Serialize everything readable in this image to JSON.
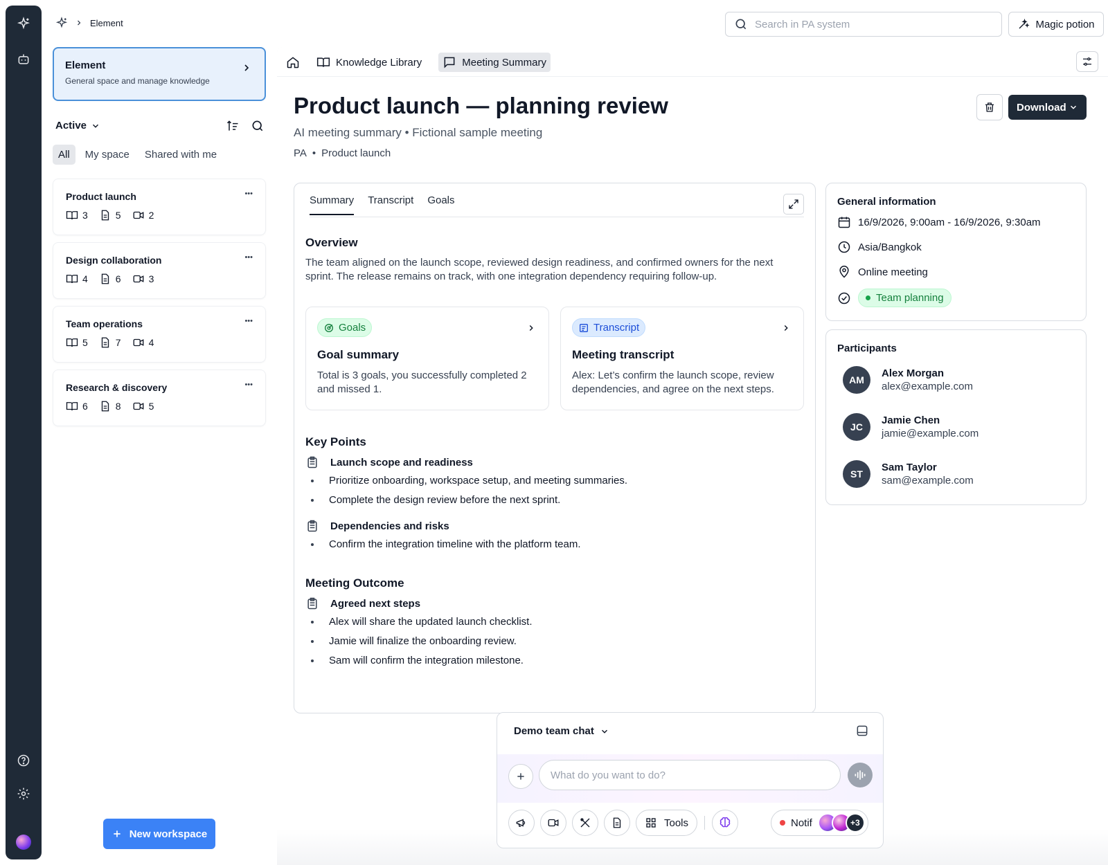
{
  "topbar": {
    "crumb": "Element",
    "search_placeholder": "Search in PA system",
    "magic_label": "Magic potion"
  },
  "sidebar": {
    "space": {
      "title": "Element",
      "description": "General space and manage knowledge"
    },
    "filter_label": "Active",
    "tabs": [
      "All",
      "My space",
      "Shared with me"
    ],
    "workspaces": [
      {
        "name": "Product launch",
        "books": "3",
        "docs": "5",
        "videos": "2"
      },
      {
        "name": "Design collaboration",
        "books": "4",
        "docs": "6",
        "videos": "3"
      },
      {
        "name": "Team operations",
        "books": "5",
        "docs": "7",
        "videos": "4"
      },
      {
        "name": "Research & discovery",
        "books": "6",
        "docs": "8",
        "videos": "5"
      }
    ],
    "new_workspace": "New workspace"
  },
  "breadcrumb": {
    "library": "Knowledge Library",
    "current": "Meeting Summary"
  },
  "meeting": {
    "title": "Product launch — planning review",
    "subtitle": "AI meeting summary • Fictional sample meeting",
    "tag_a": "PA",
    "tag_sep": "•",
    "tag_b": "Product launch",
    "download_label": "Download"
  },
  "tabs": [
    "Summary",
    "Transcript",
    "Goals"
  ],
  "summary": {
    "overview_title": "Overview",
    "overview_text": "The team aligned on the launch scope, reviewed design readiness, and confirmed owners for the next sprint. The release remains on track, with one integration dependency requiring follow-up.",
    "goals_card": {
      "badge": "Goals",
      "title": "Goal summary",
      "text": "Total is 3 goals, you successfully completed 2 and missed 1."
    },
    "transcript_card": {
      "badge": "Transcript",
      "title": "Meeting transcript",
      "text": "Alex: Let’s confirm the launch scope, review dependencies, and agree on the next steps."
    },
    "key_points_title": "Key Points",
    "key_points": [
      {
        "heading": "Launch scope and readiness",
        "items": [
          "Prioritize onboarding, workspace setup, and meeting summaries.",
          "Complete the design review before the next sprint."
        ]
      },
      {
        "heading": "Dependencies and risks",
        "items": [
          "Confirm the integration timeline with the platform team."
        ]
      }
    ],
    "outcome_title": "Meeting Outcome",
    "outcome": {
      "heading": "Agreed next steps",
      "items": [
        "Alex will share the updated launch checklist.",
        "Jamie will finalize the onboarding review.",
        "Sam will confirm the integration milestone."
      ]
    }
  },
  "general_info": {
    "title": "General information",
    "datetime": "16/9/2026, 9:00am - 16/9/2026, 9:30am",
    "timezone": "Asia/Bangkok",
    "location": "Online meeting",
    "category": "Team planning"
  },
  "participants": {
    "title": "Participants",
    "people": [
      {
        "initials": "AM",
        "name": "Alex Morgan",
        "email": "alex@example.com"
      },
      {
        "initials": "JC",
        "name": "Jamie Chen",
        "email": "jamie@example.com"
      },
      {
        "initials": "ST",
        "name": "Sam Taylor",
        "email": "sam@example.com"
      }
    ]
  },
  "chat": {
    "channel": "Demo team chat",
    "placeholder": "What do you want to do?",
    "tools_label": "Tools",
    "notif_label": "Notif",
    "more_count": "+3"
  },
  "colors": {
    "accent": "#3b82f6",
    "rail": "#1f2a37",
    "success": "#15803d",
    "link_blue": "#1d4ed8"
  }
}
